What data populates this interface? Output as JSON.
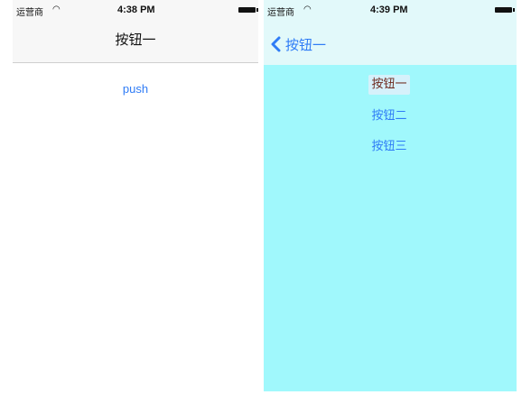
{
  "left_screen": {
    "status": {
      "carrier": "运营商",
      "wifi_icon": "wifi-icon",
      "time": "4:38 PM",
      "battery_icon": "battery-icon"
    },
    "nav_title": "按钮一",
    "push_label": "push"
  },
  "right_screen": {
    "status": {
      "carrier": "运营商",
      "wifi_icon": "wifi-icon",
      "time": "4:39 PM",
      "battery_icon": "battery-icon"
    },
    "back_label": "按钮一",
    "buttons": [
      "按钮一",
      "按钮二",
      "按钮三"
    ]
  },
  "colors": {
    "tint": "#2f7cf6",
    "right_background": "#a0f8fc",
    "right_navbar": "#e2f9fa",
    "left_navbar": "#f7f7f7",
    "selected_button_bg": "#d6f1fb",
    "selected_button_text": "#6e2a1e"
  }
}
